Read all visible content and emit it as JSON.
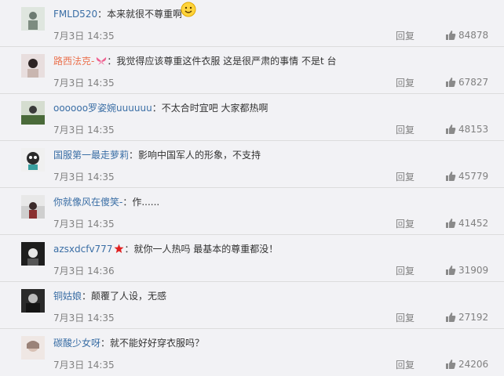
{
  "comments": [
    {
      "name": "FMLD520",
      "text": "：本来就很不尊重啊",
      "time": "7月3日 14:35",
      "reply": "回复",
      "likes": "84878",
      "name_color": "#3a6ea5"
    },
    {
      "name": "路西法克-",
      "text": "：我觉得应该尊重这件衣服 这是很严肃的事情 不是t 台",
      "time": "7月3日 14:35",
      "reply": "回复",
      "likes": "67827",
      "name_color": "#eb7350"
    },
    {
      "name": "oooooo罗姿婉uuuuuu",
      "text": "：不太合时宜吧 大家都热啊",
      "time": "7月3日 14:35",
      "reply": "回复",
      "likes": "48153",
      "name_color": "#3a6ea5"
    },
    {
      "name": "国服第一最走萝莉",
      "text": "：影响中国军人的形象，不支持",
      "time": "7月3日 14:35",
      "reply": "回复",
      "likes": "45779",
      "name_color": "#3a6ea5"
    },
    {
      "name": "你就像风在傻笑-",
      "text": "：作......",
      "time": "7月3日 14:35",
      "reply": "回复",
      "likes": "41452",
      "name_color": "#3a6ea5"
    },
    {
      "name": "azsxdcfv777",
      "text": "：就你一人热吗 最基本的尊重都没！",
      "time": "7月3日 14:36",
      "reply": "回复",
      "likes": "31909",
      "name_color": "#3a6ea5"
    },
    {
      "name": "铜姑娘",
      "text": "：颠覆了人设，无感",
      "time": "7月3日 14:35",
      "reply": "回复",
      "likes": "27192",
      "name_color": "#3a6ea5"
    },
    {
      "name": "碳酸少女呀",
      "text": "：就不能好好穿衣服吗？",
      "time": "7月3日 14:35",
      "reply": "回复",
      "likes": "24206",
      "name_color": "#3a6ea5"
    }
  ],
  "colors": {
    "bg": "#f2f2f5",
    "name": "#3a6ea5",
    "meta": "#808080",
    "star": "#e02020"
  }
}
